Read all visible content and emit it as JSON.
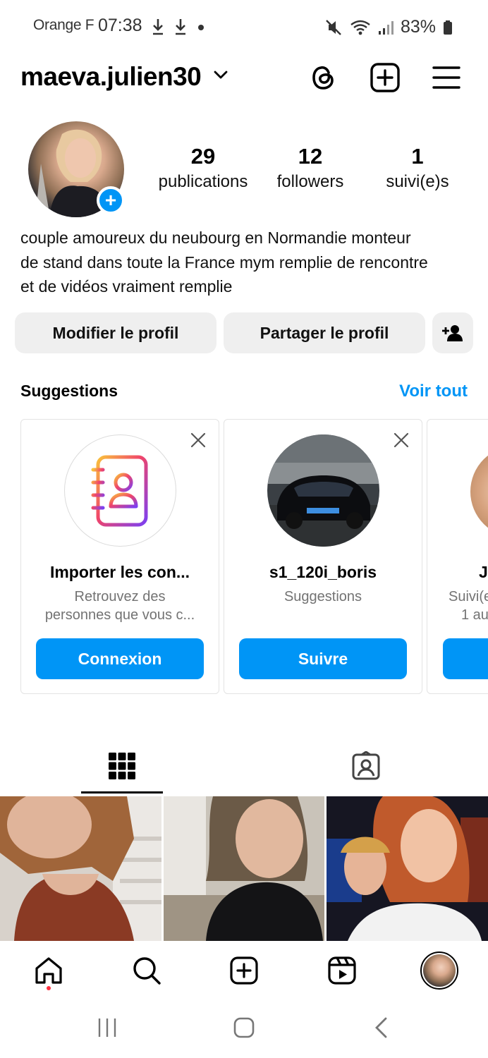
{
  "status_bar": {
    "carrier": "Orange F",
    "time": "07:38",
    "battery": "83%"
  },
  "header": {
    "username": "maeva.julien30"
  },
  "profile": {
    "stats": [
      {
        "value": "29",
        "label": "publications"
      },
      {
        "value": "12",
        "label": "followers"
      },
      {
        "value": "1",
        "label": "suivi(e)s"
      }
    ],
    "bio_lines": [
      "couple amoureux du neubourg en Normandie monteur",
      "de stand dans toute la France mym remplie de rencontre",
      "et de vidéos vraiment remplie"
    ]
  },
  "actions": {
    "edit_label": "Modifier le profil",
    "share_label": "Partager le profil"
  },
  "suggestions": {
    "title": "Suggestions",
    "see_all": "Voir tout",
    "cards": [
      {
        "name": "Importer les con...",
        "subtitle_lines": [
          "Retrouvez des",
          "personnes que vous c..."
        ],
        "button": "Connexion"
      },
      {
        "name": "s1_120i_boris",
        "subtitle_lines": [
          "Suggestions"
        ],
        "button": "Suivre"
      },
      {
        "name": "J",
        "subtitle_lines": [
          "Suivi(e",
          "1 au"
        ],
        "button": ""
      }
    ]
  },
  "colors": {
    "accent": "#0095f6",
    "notification_dot": "#ff3040",
    "button_gray": "#efefef"
  },
  "icons": {
    "header": [
      "threads-icon",
      "create-post-icon",
      "menu-icon"
    ],
    "tabs": [
      "grid-icon",
      "tagged-icon"
    ],
    "nav": [
      "home-icon",
      "search-icon",
      "create-icon",
      "reels-icon",
      "profile-avatar"
    ]
  }
}
